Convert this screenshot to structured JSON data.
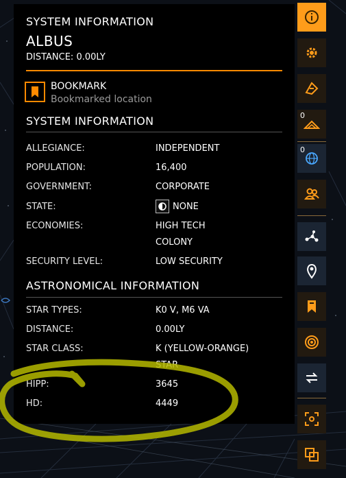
{
  "header": {
    "section_title": "SYSTEM INFORMATION",
    "system_name": "ALBUS",
    "distance": "DISTANCE: 0.00LY"
  },
  "bookmark": {
    "title": "BOOKMARK",
    "subtitle": "Bookmarked location",
    "icon": "bookmark-icon"
  },
  "system_info": {
    "heading": "SYSTEM INFORMATION",
    "allegiance_label": "ALLEGIANCE:",
    "allegiance_value": "INDEPENDENT",
    "population_label": "POPULATION:",
    "population_value": "16,400",
    "government_label": "GOVERNMENT:",
    "government_value": "CORPORATE",
    "state_label": "STATE:",
    "state_value": "NONE",
    "economies_label": "ECONOMIES:",
    "economies_values": [
      "HIGH TECH",
      "COLONY"
    ],
    "security_label": "SECURITY LEVEL:",
    "security_value": "LOW SECURITY"
  },
  "astro_info": {
    "heading": "ASTRONOMICAL INFORMATION",
    "star_types_label": "STAR TYPES:",
    "star_types_value": "K0 V, M6 VA",
    "distance_label": "DISTANCE:",
    "distance_value": "0.00LY",
    "star_class_label": "STAR CLASS:",
    "star_class_value_line1": "K (YELLOW-ORANGE)",
    "star_class_value_line2": "STAR",
    "hipp_label": "HIPP:",
    "hipp_value": "3645",
    "hd_label": "HD:",
    "hd_value": "4449"
  },
  "toolbar": {
    "items": [
      {
        "name": "info-icon",
        "active": true
      },
      {
        "name": "gear-icon"
      },
      {
        "name": "route-icon"
      },
      {
        "name": "ship-icon",
        "count": "0"
      },
      {
        "name": "globe-icon",
        "count": "0"
      },
      {
        "name": "people-icon"
      },
      {
        "name": "graph-icon"
      },
      {
        "name": "location-pin-icon"
      },
      {
        "name": "bookmark-icon"
      },
      {
        "name": "target-icon"
      },
      {
        "name": "swap-arrows-icon"
      },
      {
        "name": "expand-icon"
      },
      {
        "name": "copy-icon"
      }
    ]
  },
  "colors": {
    "accent": "#ff8a00",
    "toolbar_active": "#ff9c1a",
    "panel_bg": "#000000",
    "annotation": "#b5b800"
  }
}
